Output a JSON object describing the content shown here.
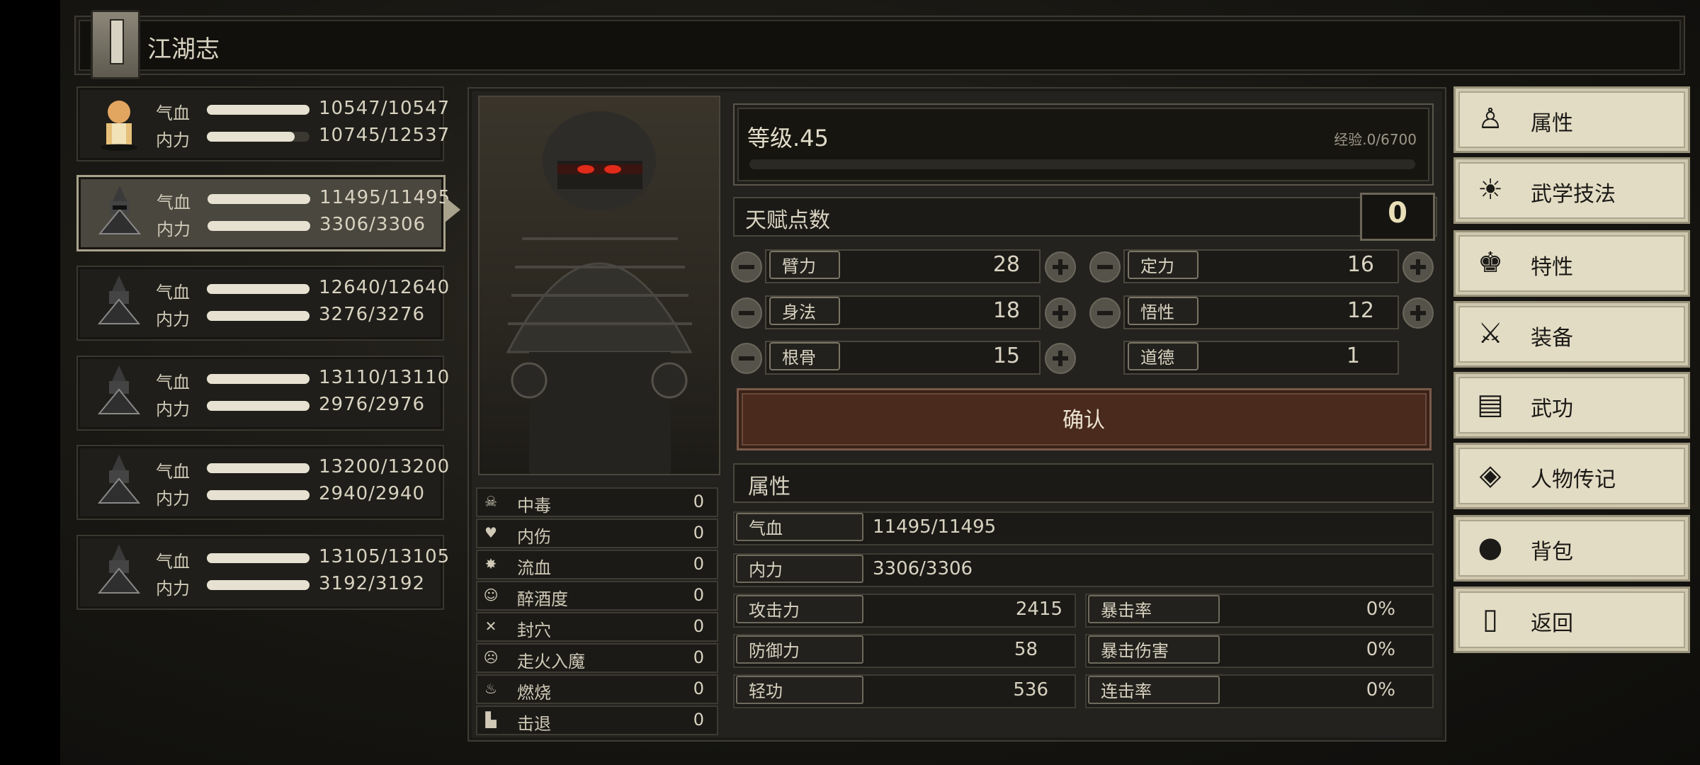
{
  "header": {
    "title": "江湖志"
  },
  "party": [
    {
      "hp_label": "气血",
      "mp_label": "内力",
      "hp": "10547/10547",
      "mp": "10745/12537",
      "hp_frac": 1.0,
      "mp_frac": 0.857,
      "avatar": "monk-avatar"
    },
    {
      "hp_label": "气血",
      "mp_label": "内力",
      "hp": "11495/11495",
      "mp": "3306/3306",
      "hp_frac": 1.0,
      "mp_frac": 1.0,
      "avatar": "armored-warrior-avatar",
      "selected": true
    },
    {
      "hp_label": "气血",
      "mp_label": "内力",
      "hp": "12640/12640",
      "mp": "3276/3276",
      "hp_frac": 1.0,
      "mp_frac": 1.0,
      "avatar": "armored-warrior-avatar"
    },
    {
      "hp_label": "气血",
      "mp_label": "内力",
      "hp": "13110/13110",
      "mp": "2976/2976",
      "hp_frac": 1.0,
      "mp_frac": 1.0,
      "avatar": "armored-warrior-avatar"
    },
    {
      "hp_label": "气血",
      "mp_label": "内力",
      "hp": "13200/13200",
      "mp": "2940/2940",
      "hp_frac": 1.0,
      "mp_frac": 1.0,
      "avatar": "armored-warrior-avatar"
    },
    {
      "hp_label": "气血",
      "mp_label": "内力",
      "hp": "13105/13105",
      "mp": "3192/3192",
      "hp_frac": 1.0,
      "mp_frac": 1.0,
      "avatar": "armored-warrior-avatar"
    }
  ],
  "status": [
    {
      "label": "中毒",
      "value": "0",
      "icon": "skull-icon"
    },
    {
      "label": "内伤",
      "value": "0",
      "icon": "broken-heart-icon"
    },
    {
      "label": "流血",
      "value": "0",
      "icon": "blood-splat-icon"
    },
    {
      "label": "醉酒度",
      "value": "0",
      "icon": "drunk-face-icon"
    },
    {
      "label": "封穴",
      "value": "0",
      "icon": "acupoint-seal-icon"
    },
    {
      "label": "走火入魔",
      "value": "0",
      "icon": "demon-face-icon"
    },
    {
      "label": "燃烧",
      "value": "0",
      "icon": "flame-icon"
    },
    {
      "label": "击退",
      "value": "0",
      "icon": "boot-icon"
    }
  ],
  "level": {
    "text": "等级.45",
    "exp": "经验.0/6700",
    "exp_frac": 0
  },
  "talent": {
    "label": "天赋点数",
    "value": "0"
  },
  "attributes": {
    "row1": [
      {
        "label": "臂力",
        "value": "28"
      },
      {
        "label": "定力",
        "value": "16"
      }
    ],
    "row2": [
      {
        "label": "身法",
        "value": "18"
      },
      {
        "label": "悟性",
        "value": "12"
      }
    ],
    "row3": [
      {
        "label": "根骨",
        "value": "15"
      },
      {
        "label": "道德",
        "value": "1"
      }
    ]
  },
  "confirm_label": "确认",
  "properties": {
    "title": "属性",
    "hp": {
      "label": "气血",
      "value": "11495/11495"
    },
    "mp": {
      "label": "内力",
      "value": "3306/3306"
    },
    "left": [
      {
        "label": "攻击力",
        "value": "2415"
      },
      {
        "label": "防御力",
        "value": "58"
      },
      {
        "label": "轻功",
        "value": "536"
      }
    ],
    "right": [
      {
        "label": "暴击率",
        "value": "0%"
      },
      {
        "label": "暴击伤害",
        "value": "0%"
      },
      {
        "label": "连击率",
        "value": "0%"
      }
    ]
  },
  "menu": [
    {
      "label": "属性",
      "icon": "character-icon"
    },
    {
      "label": "武学技法",
      "icon": "martial-skill-icon"
    },
    {
      "label": "特性",
      "icon": "trait-icon"
    },
    {
      "label": "装备",
      "icon": "sword-icon"
    },
    {
      "label": "武功",
      "icon": "manual-book-icon"
    },
    {
      "label": "人物传记",
      "icon": "scroll-icon"
    },
    {
      "label": "背包",
      "icon": "bag-icon"
    },
    {
      "label": "返回",
      "icon": "door-icon"
    }
  ]
}
